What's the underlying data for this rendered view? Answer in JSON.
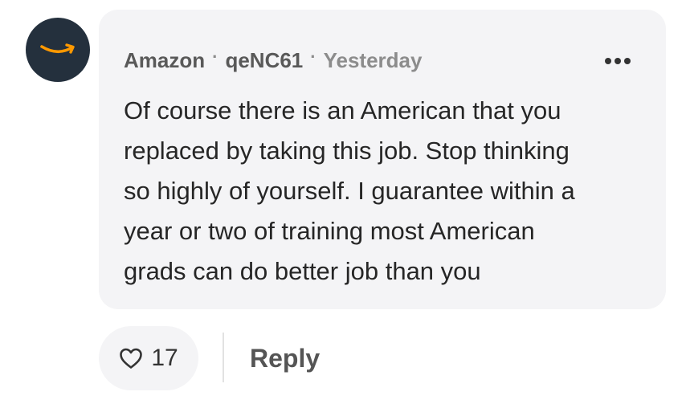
{
  "comment": {
    "avatar_icon": "amazon-smile-logo-icon",
    "avatar_bg": "#24303d",
    "logo_color": "#ff9900",
    "company": "Amazon",
    "separator": "·",
    "username": "qeNC61",
    "timestamp": "Yesterday",
    "more_icon": "more-horizontal-icon",
    "text_lines": [
      "Of course there is an American that you",
      "replaced by taking this job. Stop thinking",
      "so highly of yourself. I guarantee within a",
      "year or two of training most American",
      "grads can do better job than you"
    ]
  },
  "actions": {
    "like_icon": "heart-icon",
    "like_count": "17",
    "reply_label": "Reply"
  }
}
